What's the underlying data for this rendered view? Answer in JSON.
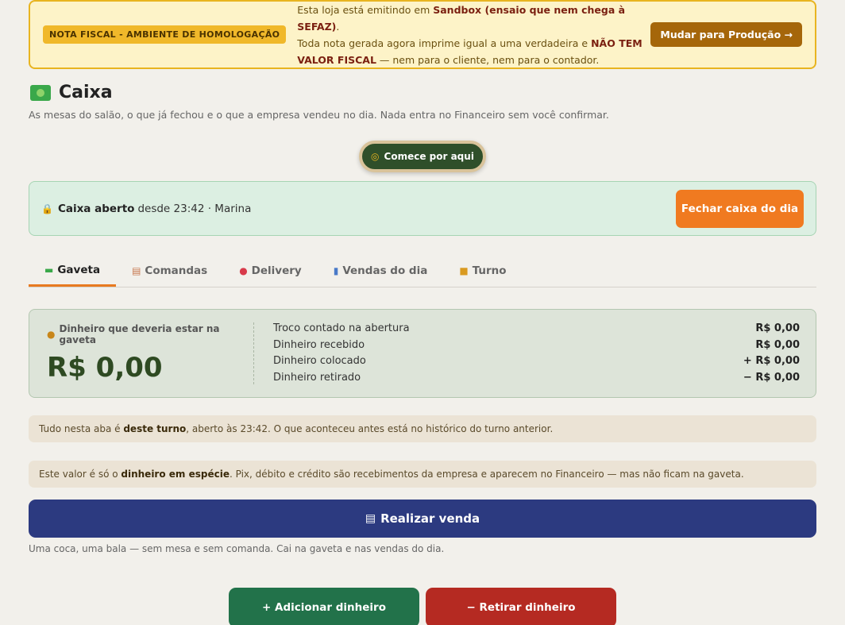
{
  "banner": {
    "badge": "NOTA FISCAL - AMBIENTE DE HOMOLOGAÇÃO",
    "line1_pre": "Esta loja está emitindo em ",
    "line1_bold": "Sandbox (ensaio que nem chega à SEFAZ)",
    "line1_post": ".",
    "line2_pre": "Toda nota gerada agora imprime igual a uma verdadeira e ",
    "line2_bold": "NÃO TEM VALOR FISCAL",
    "line2_post": " — nem para o cliente, nem para o contador.",
    "button": "Mudar para Produção →"
  },
  "header": {
    "title": "Caixa",
    "subtitle": "As mesas do salão, o que já fechou e o que a empresa vendeu no dia. Nada entra no Financeiro sem você confirmar.",
    "start_button": "Comece por aqui"
  },
  "status": {
    "bold": "Caixa aberto",
    "rest": "desde 23:42 · Marina",
    "close_button": "Fechar caixa do dia"
  },
  "tabs": [
    {
      "label": "Gaveta",
      "icon": "cash-icon",
      "active": true
    },
    {
      "label": "Comandas",
      "icon": "clipboard-icon",
      "active": false
    },
    {
      "label": "Delivery",
      "icon": "scooter-icon",
      "active": false
    },
    {
      "label": "Vendas do dia",
      "icon": "chart-icon",
      "active": false
    },
    {
      "label": "Turno",
      "icon": "lock-icon",
      "active": false
    }
  ],
  "gaveta": {
    "label": "Dinheiro que deveria estar na gaveta",
    "value": "R$ 0,00",
    "rows": [
      {
        "label": "Troco contado na abertura",
        "value": "R$ 0,00"
      },
      {
        "label": "Dinheiro recebido",
        "value": "R$ 0,00"
      },
      {
        "label": "Dinheiro colocado",
        "value": "+ R$ 0,00"
      },
      {
        "label": "Dinheiro retirado",
        "value": "− R$ 0,00"
      }
    ]
  },
  "notes": {
    "note1_pre": "Tudo nesta aba é ",
    "note1_bold": "deste turno",
    "note1_post": ", aberto às 23:42. O que aconteceu antes está no histórico do turno anterior.",
    "note2_pre": "Este valor é só o ",
    "note2_bold": "dinheiro em espécie",
    "note2_post": ". Pix, débito e crédito são recebimentos da empresa e aparecem no Financeiro — mas não ficam na gaveta."
  },
  "sale": {
    "button": "Realizar venda",
    "hint": "Uma coca, uma bala — sem mesa e sem comanda. Cai na gaveta e nas vendas do dia."
  },
  "actions": {
    "add": "+ Adicionar dinheiro",
    "remove": "− Retirar dinheiro"
  },
  "colors": {
    "accent": "#e87a20",
    "sale": "#2c3a80",
    "add": "#22724a",
    "remove": "#b52a22",
    "banner_bg": "#fdf3c8"
  }
}
